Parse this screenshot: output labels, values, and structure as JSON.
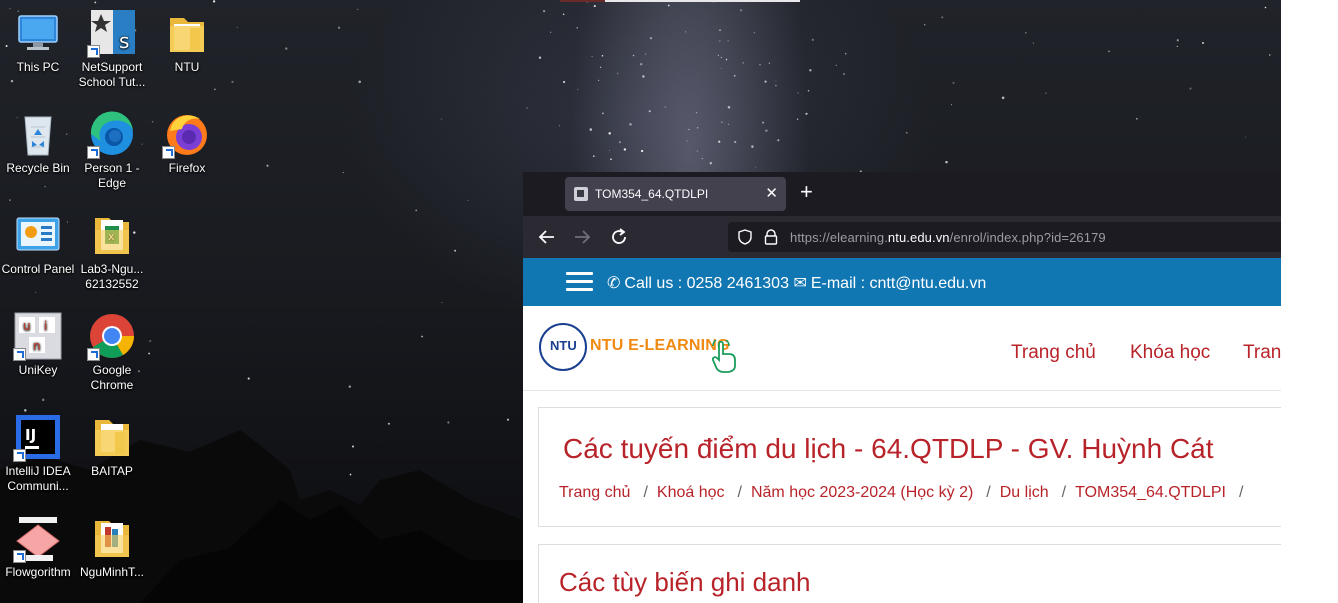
{
  "desktop": {
    "icons": [
      {
        "label": "This PC",
        "icon": "this-pc-icon"
      },
      {
        "label": "NetSupport School Tut...",
        "icon": "netsupport-icon"
      },
      {
        "label": "NTU",
        "icon": "folder-icon"
      },
      {
        "label": "Recycle Bin",
        "icon": "recycle-bin-icon"
      },
      {
        "label": "Person 1 - Edge",
        "icon": "edge-icon"
      },
      {
        "label": "Firefox",
        "icon": "firefox-icon"
      },
      {
        "label": "Control Panel",
        "icon": "control-panel-icon"
      },
      {
        "label": "Lab3-Ngu... 62132552",
        "icon": "excel-folder-icon"
      },
      {
        "label": "UniKey",
        "icon": "unikey-icon"
      },
      {
        "label": "Google Chrome",
        "icon": "chrome-icon"
      },
      {
        "label": "IntelliJ IDEA Communi...",
        "icon": "intellij-icon"
      },
      {
        "label": "BAITAP",
        "icon": "folder-icon"
      },
      {
        "label": "Flowgorithm",
        "icon": "flowgorithm-icon"
      },
      {
        "label": "NguMinhT...",
        "icon": "folder-docs-icon"
      }
    ]
  },
  "browser": {
    "tab_title": "TOM354_64.QTDLPI",
    "tab_close": "✕",
    "new_tab": "+",
    "url_prefix": "https://elearning.",
    "url_domain": "ntu.edu.vn",
    "url_path": "/enrol/index.php?id=26179"
  },
  "site": {
    "phone": "Call us : 0258 2461303",
    "email": "E-mail : cntt@ntu.edu.vn",
    "logo_badge": "NTU",
    "logo_text": "NTU E-LEARNING",
    "menu": {
      "home": "Trang chủ",
      "courses": "Khóa học",
      "more": "Tran"
    },
    "course_title": "Các tuyến điểm du lịch - 64.QTDLP - GV. Huỳnh Cát",
    "breadcrumb": [
      "Trang chủ",
      "Khoá học",
      "Năm học 2023-2024 (Học kỳ 2)",
      "Du lịch",
      "TOM354_64.QTDLPI"
    ],
    "enrol_title": "Các tùy biến ghi danh"
  },
  "colors": {
    "accent_red": "#b8232a",
    "topbar_blue": "#1177b3",
    "logo_orange": "#f08a13",
    "browser_dark": "#1c1b22"
  }
}
